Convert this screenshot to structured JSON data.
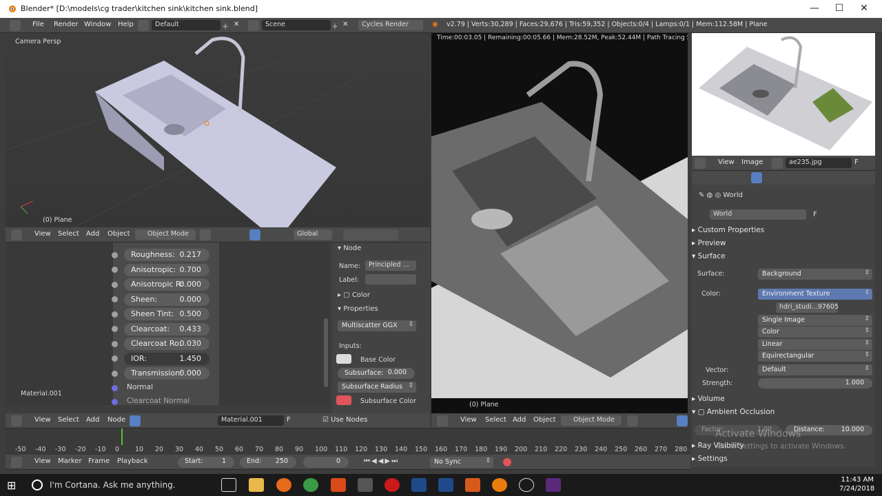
{
  "window": {
    "title": "Blender* [D:\\models\\cg trader\\kitchen sink\\kitchen sink.blend]",
    "min": "—",
    "max": "☐",
    "close": "✕"
  },
  "topbar": {
    "menus": [
      "File",
      "Render",
      "Window",
      "Help"
    ],
    "layout": "Default",
    "scene": "Scene",
    "engine": "Cycles Render",
    "stats": "v2.79 | Verts:30,289 | Faces:29,676 | Tris:59,352 | Objects:0/4 | Lamps:0/1 | Mem:112.58M | Plane"
  },
  "viewport_left": {
    "label": "Camera Persp",
    "object": "(0) Plane",
    "menus": [
      "View",
      "Select",
      "Add",
      "Object"
    ],
    "mode": "Object Mode",
    "orientation": "Global"
  },
  "render_view": {
    "status": "Time:00:03.05 | Remaining:00:05.66 | Mem:28.52M, Peak:52.44M | Path Tracing Sample 1",
    "object": "(0) Plane",
    "menus": [
      "View",
      "Select",
      "Add",
      "Object"
    ],
    "mode": "Object Mode"
  },
  "node_editor": {
    "material_label": "Material.001",
    "sliders": [
      {
        "label": "Roughness:",
        "value": "0.217"
      },
      {
        "label": "Anisotropic:",
        "value": "0.700"
      },
      {
        "label": "Anisotropic R:",
        "value": "0.000"
      },
      {
        "label": "Sheen:",
        "value": "0.000"
      },
      {
        "label": "Sheen Tint:",
        "value": "0.500"
      },
      {
        "label": "Clearcoat:",
        "value": "0.433"
      },
      {
        "label": "Clearcoat Ro:",
        "value": "0.030"
      },
      {
        "label": "IOR:",
        "value": "1.450"
      },
      {
        "label": "Transmission:",
        "value": "0.000"
      }
    ],
    "normal": "Normal",
    "clearcoat_normal": "Clearcoat Normal",
    "menus": [
      "View",
      "Select",
      "Add",
      "Node"
    ],
    "material": "Material.001",
    "use_nodes": "Use Nodes"
  },
  "node_side": {
    "node_header": "Node",
    "name_label": "Name:",
    "name_value": "Principled ...",
    "label_label": "Label:",
    "color": "Color",
    "properties": "Properties",
    "distribution": "Multiscatter GGX",
    "inputs": "Inputs:",
    "base_color": "Base Color",
    "subsurface_label": "Subsurface:",
    "subsurface_value": "0.000",
    "subsurface_radius": "Subsurface Radius",
    "subsurface_color": "Subsurface Color"
  },
  "image_editor": {
    "menus": [
      "View",
      "Image"
    ],
    "image": "ae235.jpg",
    "f": "F"
  },
  "properties": {
    "world_crumb": "World",
    "world_name": "World",
    "f": "F",
    "custom_props": "Custom Properties",
    "preview": "Preview",
    "surface": "Surface",
    "surface_label": "Surface:",
    "surface_value": "Background",
    "color_label": "Color:",
    "color_value": "Environment Texture",
    "hdri": "hdri_studi...976055",
    "single_image": "Single Image",
    "color_space": "Color",
    "interp": "Linear",
    "projection": "Equirectangular",
    "vector_label": "Vector:",
    "vector_value": "Default",
    "strength_label": "Strength:",
    "strength_value": "1.000",
    "volume": "Volume",
    "ao": "Ambient Occlusion",
    "factor_label": "Factor:",
    "factor_value": "1.00",
    "distance_label": "Distance:",
    "distance_value": "10.000",
    "ray_vis": "Ray Visibility",
    "settings": "Settings",
    "watermark1": "Activate Windows",
    "watermark2": "Go to Settings to activate Windows."
  },
  "timeline": {
    "ticks": [
      "-50",
      "-40",
      "-30",
      "-20",
      "-10",
      "0",
      "10",
      "20",
      "30",
      "40",
      "50",
      "60",
      "70",
      "80",
      "90",
      "100",
      "110",
      "120",
      "130",
      "140",
      "150",
      "160",
      "170",
      "180",
      "190",
      "200",
      "210",
      "220",
      "230",
      "240",
      "250",
      "260",
      "270",
      "280"
    ],
    "menus": [
      "View",
      "Marker",
      "Frame",
      "Playback"
    ],
    "start_label": "Start:",
    "start": "1",
    "end_label": "End:",
    "end": "250",
    "current": "0",
    "sync": "No Sync"
  },
  "taskbar": {
    "search": "I'm Cortana. Ask me anything.",
    "time": "11:43 AM",
    "date": "7/24/2018"
  },
  "colors": {
    "accent": "#5680c2",
    "selected": "#5e79b0",
    "subsurface": "#e0555a",
    "orange": "#e87d0d"
  }
}
